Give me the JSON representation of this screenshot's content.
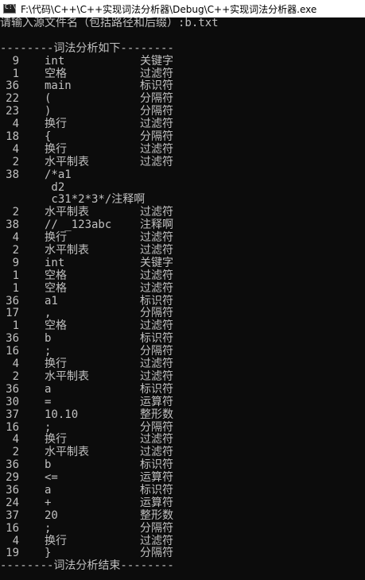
{
  "window": {
    "title": "F:\\代码\\C++\\C++实现词法分析器\\Debug\\C++实现词法分析器.exe",
    "icon": "console-app-icon"
  },
  "console": {
    "prompt": "请输入源文件名（包括路径和后缀）:b.txt",
    "blank": "",
    "header": "--------词法分析如下--------",
    "footer": "--------词法分析结束--------",
    "rows": [
      {
        "code": "9",
        "word": "int",
        "type": "关键字"
      },
      {
        "code": "1",
        "word": "空格",
        "type": "过滤符"
      },
      {
        "code": "36",
        "word": "main",
        "type": "标识符"
      },
      {
        "code": "22",
        "word": "(",
        "type": "分隔符"
      },
      {
        "code": "23",
        "word": ")",
        "type": "分隔符"
      },
      {
        "code": "4",
        "word": "换行",
        "type": "过滤符"
      },
      {
        "code": "18",
        "word": "{",
        "type": "分隔符"
      },
      {
        "code": "4",
        "word": "换行",
        "type": "过滤符"
      },
      {
        "code": "2",
        "word": "水平制表",
        "type": "过滤符"
      },
      {
        "code": "38",
        "word": "/*a1",
        "type": ""
      },
      {
        "code": "",
        "word": " d2",
        "type": ""
      },
      {
        "code": "",
        "word": " c31*2*3*/注释啊",
        "type": ""
      },
      {
        "code": "2",
        "word": "水平制表",
        "type": "过滤符"
      },
      {
        "code": "38",
        "word": "// _123abc",
        "type": "注释啊"
      },
      {
        "code": "4",
        "word": "换行",
        "type": "过滤符"
      },
      {
        "code": "2",
        "word": "水平制表",
        "type": "过滤符"
      },
      {
        "code": "9",
        "word": "int",
        "type": "关键字"
      },
      {
        "code": "1",
        "word": "空格",
        "type": "过滤符"
      },
      {
        "code": "1",
        "word": "空格",
        "type": "过滤符"
      },
      {
        "code": "36",
        "word": "a1",
        "type": "标识符"
      },
      {
        "code": "17",
        "word": ",",
        "type": "分隔符"
      },
      {
        "code": "1",
        "word": "空格",
        "type": "过滤符"
      },
      {
        "code": "36",
        "word": "b",
        "type": "标识符"
      },
      {
        "code": "16",
        "word": ";",
        "type": "分隔符"
      },
      {
        "code": "4",
        "word": "换行",
        "type": "过滤符"
      },
      {
        "code": "2",
        "word": "水平制表",
        "type": "过滤符"
      },
      {
        "code": "36",
        "word": "a",
        "type": "标识符"
      },
      {
        "code": "30",
        "word": "=",
        "type": "运算符"
      },
      {
        "code": "37",
        "word": "10.10",
        "type": "整形数"
      },
      {
        "code": "16",
        "word": ";",
        "type": "分隔符"
      },
      {
        "code": "4",
        "word": "换行",
        "type": "过滤符"
      },
      {
        "code": "2",
        "word": "水平制表",
        "type": "过滤符"
      },
      {
        "code": "36",
        "word": "b",
        "type": "标识符"
      },
      {
        "code": "29",
        "word": "<=",
        "type": "运算符"
      },
      {
        "code": "36",
        "word": "a",
        "type": "标识符"
      },
      {
        "code": "24",
        "word": "+",
        "type": "运算符"
      },
      {
        "code": "37",
        "word": "20",
        "type": "整形数"
      },
      {
        "code": "16",
        "word": ";",
        "type": "分隔符"
      },
      {
        "code": "4",
        "word": "换行",
        "type": "过滤符"
      },
      {
        "code": "19",
        "word": "}",
        "type": "分隔符"
      }
    ]
  }
}
